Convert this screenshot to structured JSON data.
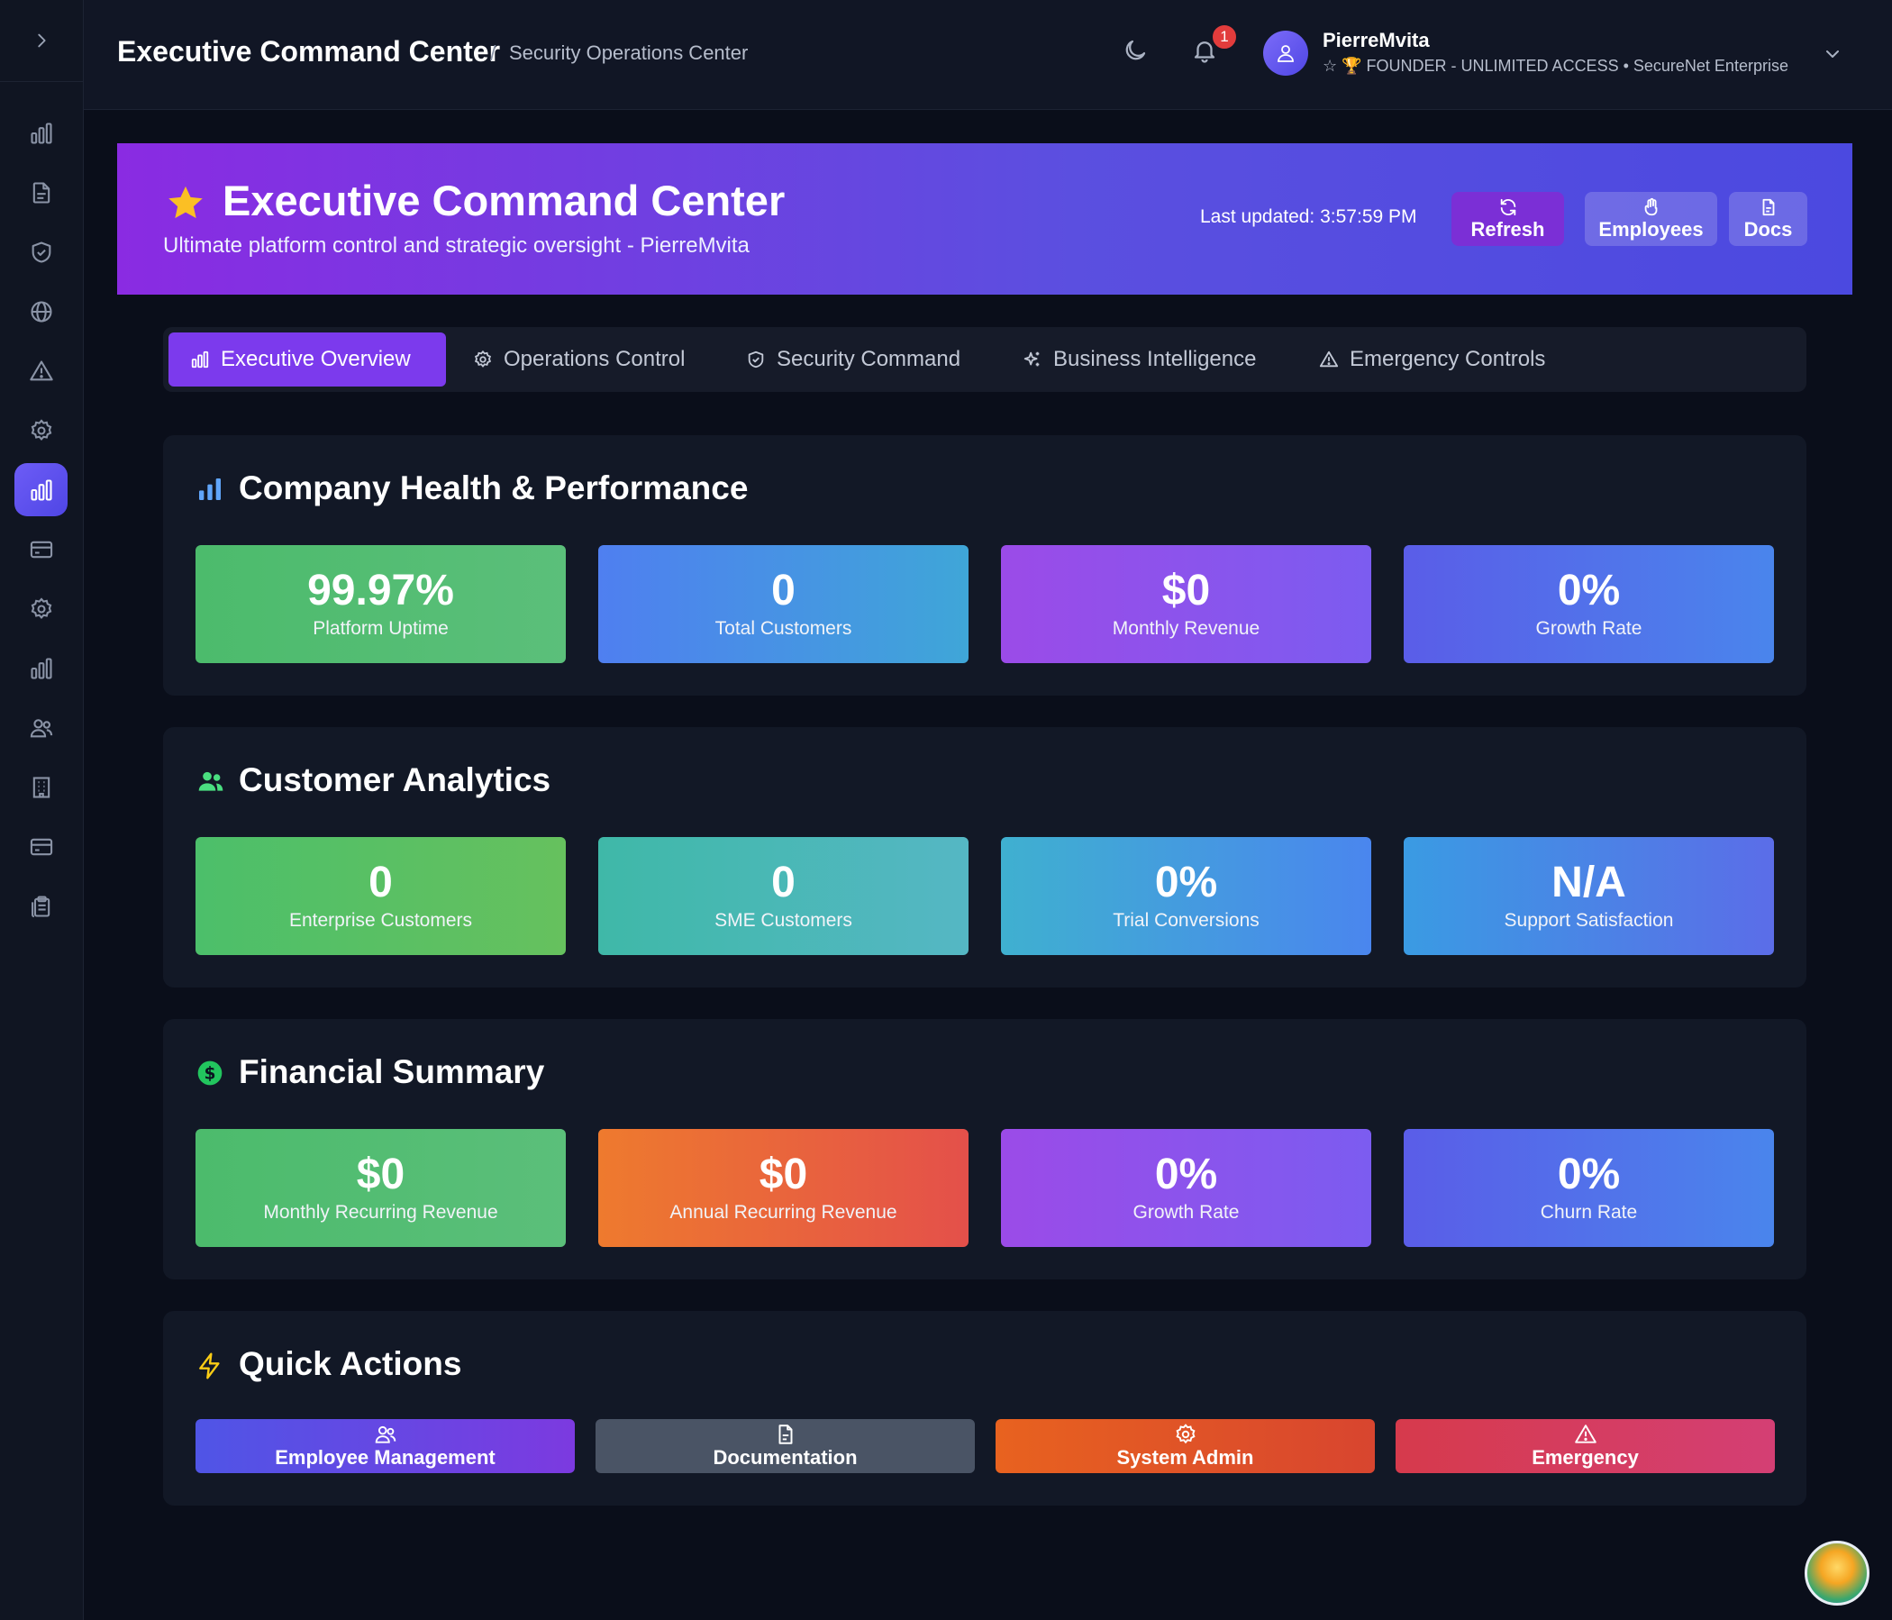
{
  "header": {
    "title": "Executive Command Center",
    "separator": "/",
    "subtitle": "Security Operations Center",
    "notification_count": "1",
    "user": {
      "name": "PierreMvita",
      "role": "☆ 🏆 FOUNDER - UNLIMITED ACCESS • SecureNet Enterprise"
    }
  },
  "sidebar": {
    "items": [
      {
        "icon": "bar-chart-icon"
      },
      {
        "icon": "file-icon"
      },
      {
        "icon": "shield-check-icon"
      },
      {
        "icon": "globe-icon"
      },
      {
        "icon": "alert-triangle-icon"
      },
      {
        "icon": "gear-icon"
      },
      {
        "icon": "bar-chart-icon",
        "active": true
      },
      {
        "icon": "credit-card-icon"
      },
      {
        "icon": "gear-icon"
      },
      {
        "icon": "bar-chart-icon"
      },
      {
        "icon": "users-icon"
      },
      {
        "icon": "building-icon"
      },
      {
        "icon": "credit-card-icon"
      },
      {
        "icon": "clipboard-icon"
      }
    ]
  },
  "banner": {
    "title": "Executive Command Center",
    "subtitle": "Ultimate platform control and strategic oversight - PierreMvita",
    "last_updated": "Last updated: 3:57:59 PM",
    "refresh_label": "Refresh",
    "employees_label": "Employees",
    "docs_label": "Docs"
  },
  "tabs": [
    {
      "label": "Executive Overview",
      "active": true
    },
    {
      "label": "Operations Control"
    },
    {
      "label": "Security Command"
    },
    {
      "label": "Business Intelligence"
    },
    {
      "label": "Emergency Controls"
    }
  ],
  "sections": {
    "health": {
      "title": "Company Health & Performance",
      "cards": [
        {
          "value": "99.97%",
          "label": "Platform Uptime"
        },
        {
          "value": "0",
          "label": "Total Customers"
        },
        {
          "value": "$0",
          "label": "Monthly Revenue"
        },
        {
          "value": "0%",
          "label": "Growth Rate"
        }
      ]
    },
    "customers": {
      "title": "Customer Analytics",
      "cards": [
        {
          "value": "0",
          "label": "Enterprise Customers"
        },
        {
          "value": "0",
          "label": "SME Customers"
        },
        {
          "value": "0%",
          "label": "Trial Conversions"
        },
        {
          "value": "N/A",
          "label": "Support Satisfaction"
        }
      ]
    },
    "financial": {
      "title": "Financial Summary",
      "cards": [
        {
          "value": "$0",
          "label": "Monthly Recurring Revenue"
        },
        {
          "value": "$0",
          "label": "Annual Recurring Revenue"
        },
        {
          "value": "0%",
          "label": "Growth Rate"
        },
        {
          "value": "0%",
          "label": "Churn Rate"
        }
      ]
    },
    "quick_actions": {
      "title": "Quick Actions",
      "buttons": [
        {
          "label": "Employee Management",
          "icon": "users-icon"
        },
        {
          "label": "Documentation",
          "icon": "file-icon"
        },
        {
          "label": "System Admin",
          "icon": "gear-icon"
        },
        {
          "label": "Emergency",
          "icon": "alert-triangle-icon"
        }
      ]
    }
  },
  "colors": {
    "accent": "#7c3aed",
    "background": "#0a0e1a",
    "panel": "#121826",
    "notification": "#e23c3c"
  }
}
